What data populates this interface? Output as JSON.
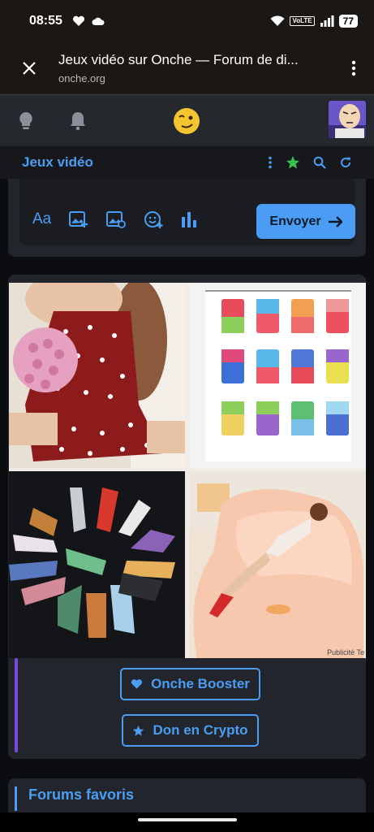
{
  "status_bar": {
    "time": "08:55",
    "network": "VoLTE",
    "battery": "77"
  },
  "browser": {
    "title": "Jeux vidéo sur Onche — Forum de di...",
    "domain": "onche.org"
  },
  "forum": {
    "title": "Jeux vidéo"
  },
  "composer": {
    "format_label": "Aa",
    "send_label": "Envoyer"
  },
  "ad": {
    "images": [
      "red-heart-dress-with-roses",
      "disposable-vape-variety-pack",
      "crystal-gemstone-carvings",
      "giant-body-pillow-bed"
    ],
    "publicite_label": "Publicité Te",
    "buttons": {
      "booster": "Onche Booster",
      "crypto": "Don en Crypto"
    }
  },
  "favorites": {
    "title": "Forums favoris"
  },
  "colors": {
    "accent": "#4a9df2",
    "ad_strip": "#7c4ae3",
    "card_bg": "#22252b"
  }
}
